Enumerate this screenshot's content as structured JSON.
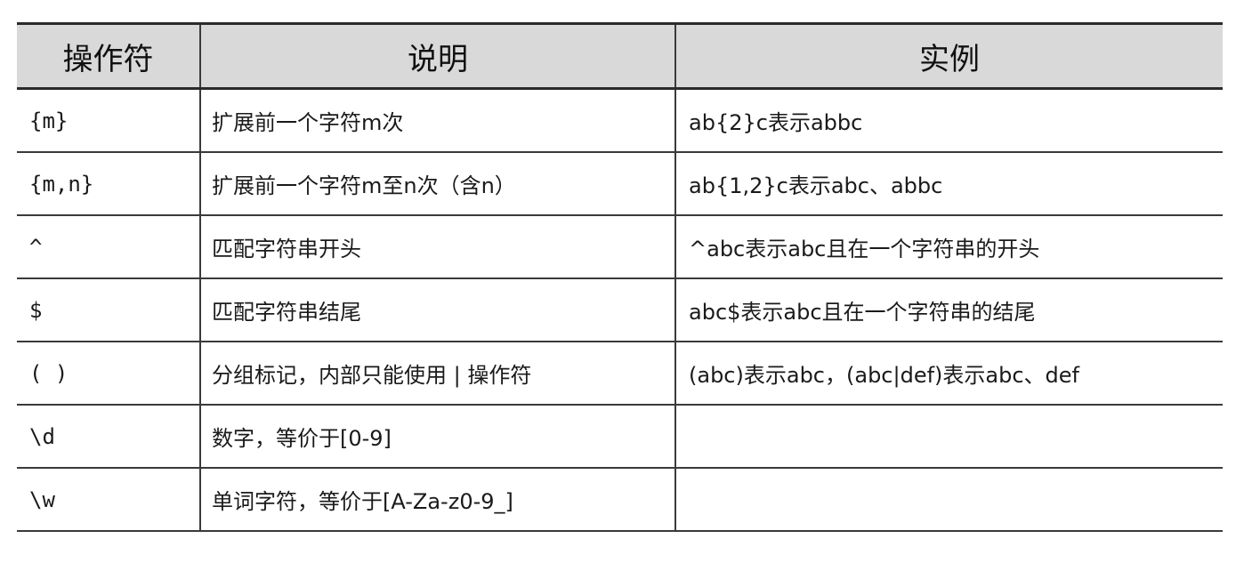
{
  "header": {
    "col1": "操作符",
    "col2": "说明",
    "col3": "实例"
  },
  "rows": [
    {
      "operator": "{m}",
      "description": "扩展前一个字符m次",
      "example": "ab{2}c表示abbc"
    },
    {
      "operator": "{m,n}",
      "description": "扩展前一个字符m至n次（含n）",
      "example": "ab{1,2}c表示abc、abbc"
    },
    {
      "operator": "^",
      "description": "匹配字符串开头",
      "example": "^abc表示abc且在一个字符串的开头"
    },
    {
      "operator": "$",
      "description": "匹配字符串结尾",
      "example": "abc$表示abc且在一个字符串的结尾"
    },
    {
      "operator": "( )",
      "description": "分组标记，内部只能使用 | 操作符",
      "example": "(abc)表示abc，(abc|def)表示abc、def"
    },
    {
      "operator": "\\d",
      "description": "数字，等价于[0-9]",
      "example": ""
    },
    {
      "operator": "\\w",
      "description": "单词字符，等价于[A-Za-z0-9_]",
      "example": ""
    }
  ]
}
